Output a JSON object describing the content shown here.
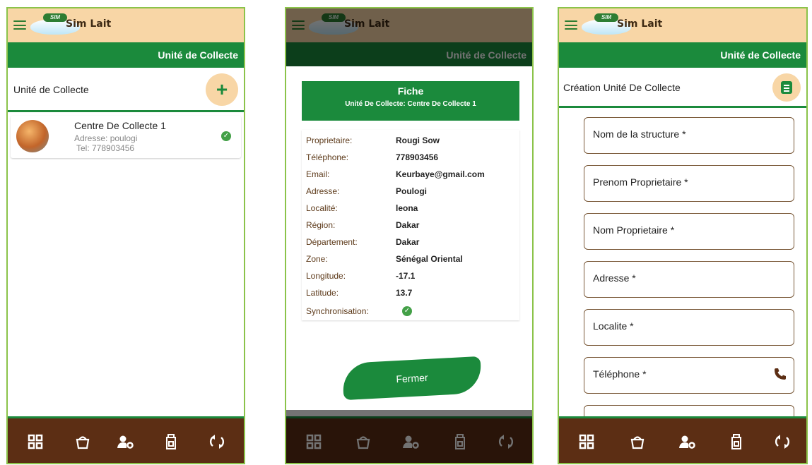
{
  "app": {
    "name": "Sim Lait",
    "logo_badge": "SIM",
    "screen_title": "Unité de Collecte"
  },
  "colors": {
    "primary": "#1b8a3c",
    "header": "#f8d6a6",
    "nav": "#5c2e14",
    "success": "#43a047"
  },
  "nav_icons": [
    "grid-icon",
    "bucket-icon",
    "user-settings-icon",
    "milk-can-icon",
    "sync-icon"
  ],
  "screen1": {
    "subheader": "Unité de Collecte",
    "add_label": "+",
    "items": [
      {
        "name": "Centre De Collecte 1",
        "address": "Adresse: poulogi",
        "tel": "Tel: 778903456",
        "synced": true
      }
    ]
  },
  "screen2": {
    "fiche_title": "Fiche",
    "fiche_subtitle": "Unité De Collecte: Centre De Collecte 1",
    "rows": [
      {
        "label": "Proprietaire:",
        "value": "Rougi Sow"
      },
      {
        "label": "Téléphone:",
        "value": "778903456"
      },
      {
        "label": "Email:",
        "value": "Keurbaye@gmail.com"
      },
      {
        "label": "Adresse:",
        "value": "Poulogi"
      },
      {
        "label": "Localité:",
        "value": "leona"
      },
      {
        "label": "Région:",
        "value": "Dakar"
      },
      {
        "label": "Département:",
        "value": "Dakar"
      },
      {
        "label": "Zone:",
        "value": "Sénégal Oriental"
      },
      {
        "label": "Longitude:",
        "value": "-17.1"
      },
      {
        "label": "Latitude:",
        "value": "13.7"
      }
    ],
    "sync_label": "Synchronisation:",
    "close_button": "Fermer"
  },
  "screen3": {
    "subheader": "Création Unité De Collecte",
    "fields": [
      {
        "label": "Nom de la structure",
        "required": "*"
      },
      {
        "label": "Prenom Proprietaire",
        "required": "*"
      },
      {
        "label": "Nom Proprietaire",
        "required": "*"
      },
      {
        "label": "Adresse",
        "required": "*"
      },
      {
        "label": "Localite",
        "required": "*"
      },
      {
        "label": "Téléphone",
        "required": "*"
      }
    ]
  }
}
